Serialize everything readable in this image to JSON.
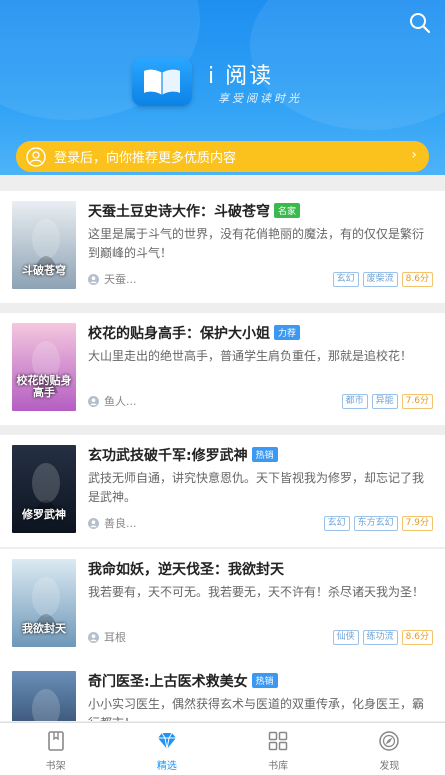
{
  "header": {
    "app_name": "i 阅读",
    "slogan": "享受阅读时光",
    "login_banner": "登录后，向你推荐更多优质内容"
  },
  "colors": {
    "brand_blue": "#1f93f2",
    "banner_yellow": "#fbc21e",
    "badge_green": "#3bb94f",
    "badge_blue": "#3c98f0"
  },
  "books": [
    {
      "title": "天蚕土豆史诗大作：斗破苍穹",
      "badge": "名家",
      "badge_color": "#3bb94f",
      "description": "这里是属于斗气的世界，没有花俏艳丽的魔法，有的仅仅是繁衍到巅峰的斗气！",
      "author": "天蚕...",
      "tags": [
        "玄幻",
        "废柴流"
      ],
      "score": "8.6分",
      "cover_text": "斗破苍穹",
      "cover_colors": [
        "#e9eef2",
        "#8da2b4"
      ]
    },
    {
      "title": "校花的贴身高手：保护大小姐",
      "badge": "力荐",
      "badge_color": "#3c98f0",
      "description": "大山里走出的绝世高手，普通学生肩负重任，那就是追校花！",
      "author": "鱼人...",
      "tags": [
        "都市",
        "异能"
      ],
      "score": "7.6分",
      "cover_text": "校花的贴身高手",
      "cover_colors": [
        "#f4c7de",
        "#b45ec2"
      ]
    },
    {
      "title": "玄功武技破千军:修罗武神",
      "badge": "热销",
      "badge_color": "#3c98f0",
      "description": "武技无师自通，讲究快意恩仇。天下皆视我为修罗，却忘记了我是武神。",
      "author": "善良...",
      "tags": [
        "玄幻",
        "东方玄幻"
      ],
      "score": "7.9分",
      "cover_text": "修罗武神",
      "cover_colors": [
        "#243043",
        "#0d1420"
      ]
    },
    {
      "title": "我命如妖，逆天伐圣：我欲封天",
      "badge": "",
      "badge_color": "",
      "description": "我若要有，天不可无。我若要无，天不许有！杀尽诸天我为圣！",
      "author": "耳根",
      "tags": [
        "仙侠",
        "练功流"
      ],
      "score": "8.6分",
      "cover_text": "我欲封天",
      "cover_colors": [
        "#dceaf2",
        "#6e97b8"
      ]
    },
    {
      "title": "奇门医圣:上古医术救美女",
      "badge": "热销",
      "badge_color": "#3c98f0",
      "description": "小小实习医生，偶然获得玄术与医道的双重传承，化身医王，霸行都市！",
      "author": "",
      "tags": [],
      "score": "",
      "cover_text": "",
      "cover_colors": [
        "#6a8fb8",
        "#1f3554"
      ]
    }
  ],
  "tabs": [
    {
      "label": "书架",
      "icon": "bookshelf-icon",
      "active": false
    },
    {
      "label": "精选",
      "icon": "diamond-icon",
      "active": true
    },
    {
      "label": "书库",
      "icon": "grid-icon",
      "active": false
    },
    {
      "label": "发现",
      "icon": "compass-icon",
      "active": false
    }
  ]
}
